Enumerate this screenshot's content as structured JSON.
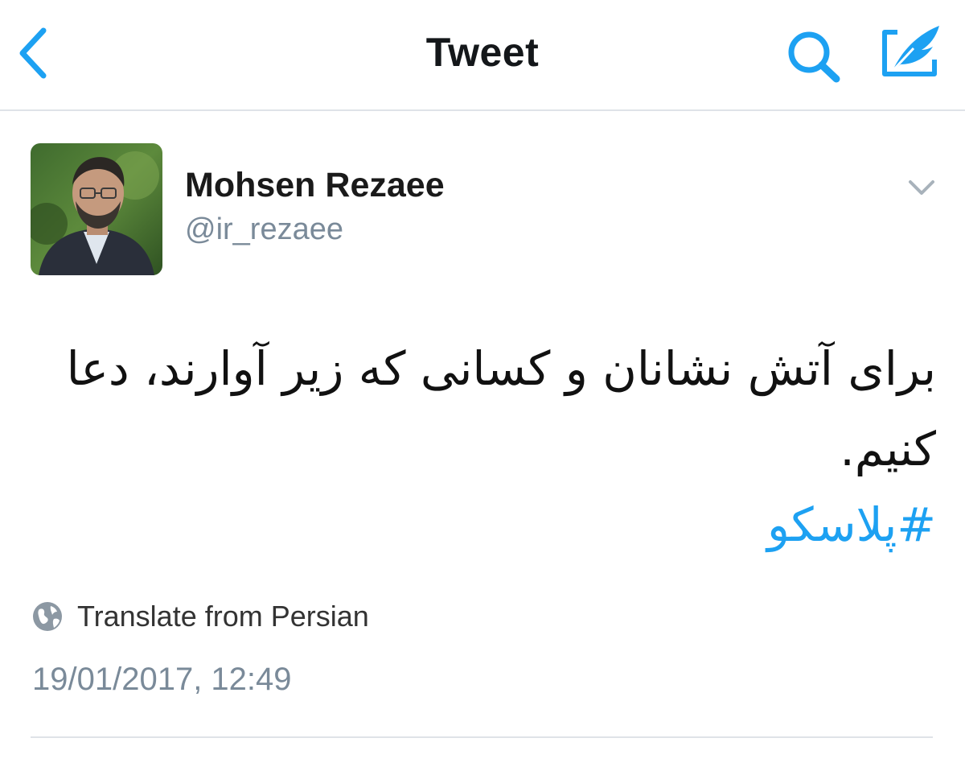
{
  "header": {
    "title": "Tweet",
    "back_icon": "chevron-left-icon",
    "search_icon": "search-icon",
    "compose_icon": "compose-tweet-icon"
  },
  "tweet": {
    "author": {
      "name": "Mohsen Rezaee",
      "handle": "@ir_rezaee"
    },
    "text": "برای آتش نشانان و کسانی که زیر آوارند، دعا کنیم.",
    "hashtag": "#پلاسکو",
    "translate_label": "Translate from Persian",
    "timestamp": "19/01/2017, 12:49"
  },
  "colors": {
    "accent": "#1da1f2",
    "text": "#14171a",
    "secondary": "#7a8a99",
    "divider": "#dfe3e8"
  }
}
